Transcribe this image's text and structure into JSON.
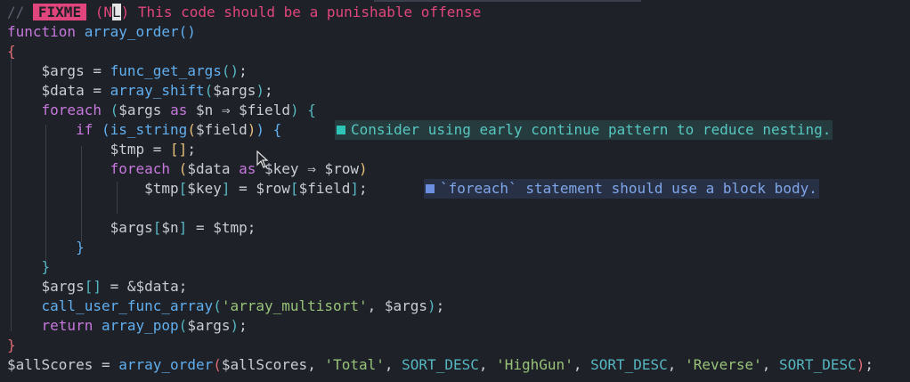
{
  "comment": {
    "slashes": "//",
    "tag": "FIXME",
    "paren_open": "(",
    "author_a": "N",
    "author_cursor": "L",
    "paren_close": ")",
    "message": " This code should be a punishable offense"
  },
  "code": {
    "l1_kw": "function",
    "l1_fn": "array_order",
    "l1_paren": "()",
    "l2_brace": "{",
    "l3_var": "$args",
    "l3_fn": "func_get_args",
    "l4_var": "$data",
    "l4_fn": "array_shift",
    "l4_arg": "$args",
    "l5_kw": "foreach",
    "l5_a": "$args",
    "l5_as": "as",
    "l5_n": "$n",
    "l5_arrow": "⇒",
    "l5_field": "$field",
    "l6_kw": "if",
    "l6_fn": "is_string",
    "l6_arg": "$field",
    "l7_var": "$tmp",
    "l8_kw": "foreach",
    "l8_a": "$data",
    "l8_as": "as",
    "l8_key": "$key",
    "l8_arrow": "⇒",
    "l8_row": "$row",
    "l9_tmp": "$tmp",
    "l9_key": "$key",
    "l9_row": "$row",
    "l9_field": "$field",
    "l11_args": "$args",
    "l11_n": "$n",
    "l11_tmp": "$tmp",
    "l12_brace": "}",
    "l13_brace": "}",
    "l14_args": "$args",
    "l14_data": "$data",
    "l15_fn": "call_user_func_array",
    "l15_str": "'array_multisort'",
    "l15_args": "$args",
    "l16_kw": "return",
    "l16_fn": "array_pop",
    "l16_args": "$args",
    "l17_brace": "}",
    "l18_var": "$allScores",
    "l18_fn": "array_order",
    "l18_arg": "$allScores",
    "l18_s1": "'Total'",
    "l18_c1": "SORT_DESC",
    "l18_s2": "'HighGun'",
    "l18_c2": "SORT_DESC",
    "l18_s3": "'Reverse'",
    "l18_c3": "SORT_DESC"
  },
  "diagnostics": {
    "hint": "Consider using early continue pattern to reduce nesting.",
    "info": "`foreach` statement should use a block body."
  },
  "colors": {
    "background": "#1e2127",
    "fixme": "#e0467c",
    "hint": "#2ec4b6",
    "info": "#6c8fe0"
  }
}
